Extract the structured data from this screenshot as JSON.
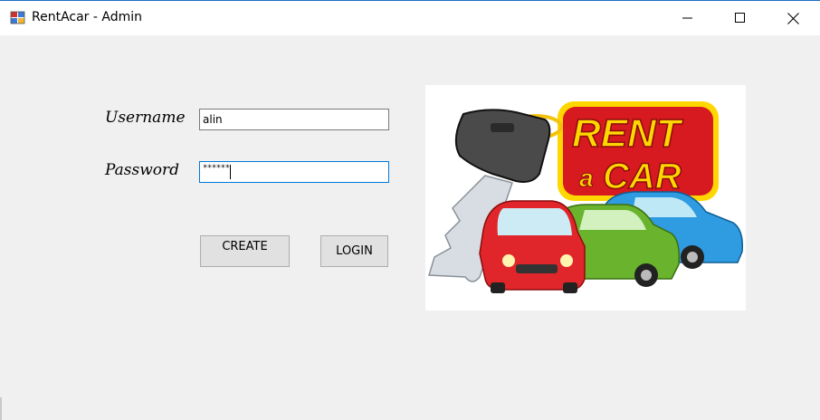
{
  "window": {
    "title": "RentAcar - Admin",
    "app_icon": "windows-form-icon",
    "controls": [
      "minimize-icon",
      "maximize-icon",
      "close-icon"
    ]
  },
  "form": {
    "username_label": "Username",
    "username_value": "alin",
    "password_label": "Password",
    "password_masked": "******"
  },
  "buttons": {
    "create": "CREATE",
    "login": "LOGIN"
  },
  "logo": {
    "line1": "RENT",
    "line2_small": "a",
    "line2_big": "CAR"
  },
  "colors": {
    "accent": "#0078d7",
    "logo_red": "#d71920",
    "logo_yellow": "#ffd700",
    "car_red": "#e0262b",
    "car_green": "#6ab42d",
    "car_blue": "#2f9be0"
  }
}
